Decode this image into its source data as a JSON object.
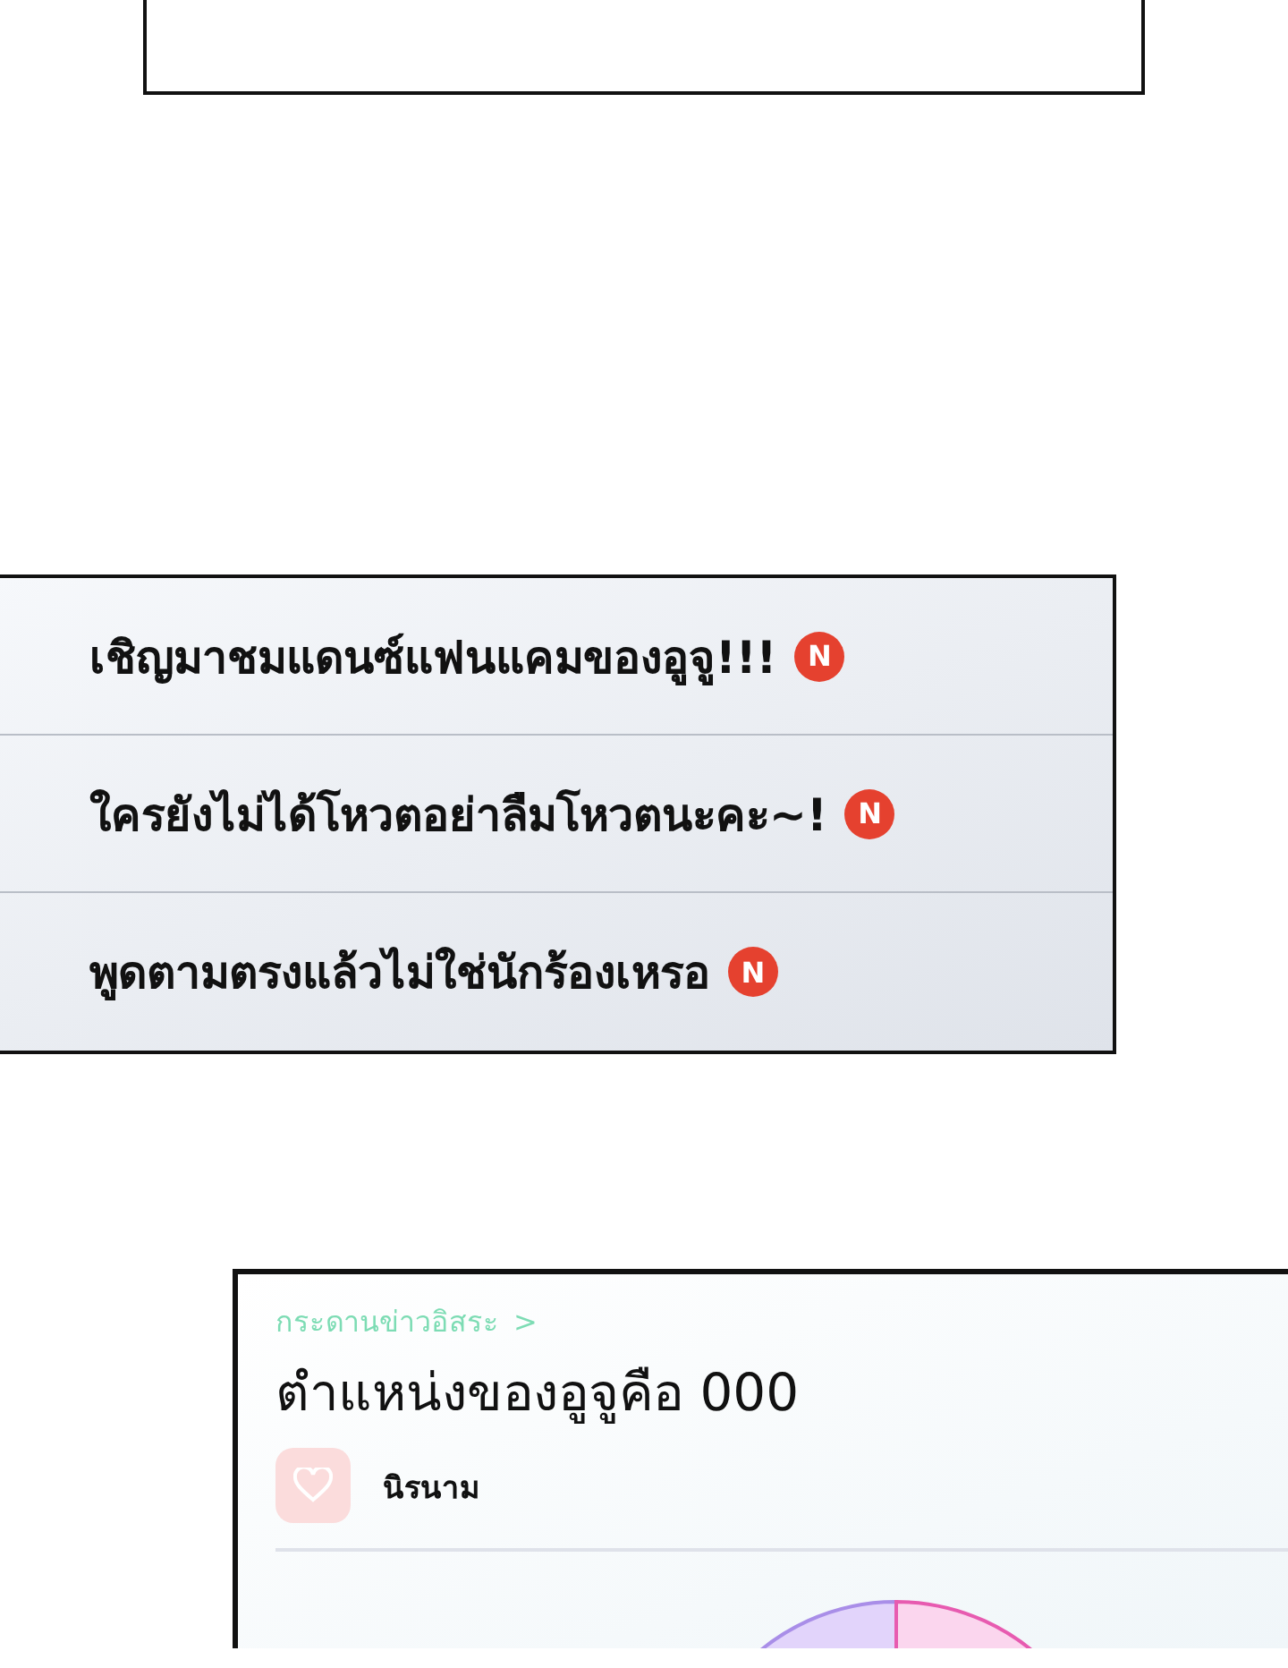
{
  "notices": [
    {
      "text": "เชิญมาชมแดนซ์แฟนแคมของอูจู!!!",
      "badge": "N"
    },
    {
      "text": "ใครยังไม่ได้โหวตอย่าลืมโหวตนะคะ~!",
      "badge": "N"
    },
    {
      "text": "พูดตามตรงแล้วไม่ใช่นักร้องเหรอ",
      "badge": "N"
    }
  ],
  "post": {
    "board": "กระดานข่าวอิสระ",
    "chevron": ">",
    "title": "ตำแหน่งของอูจูคือ 000",
    "author": "นิรนาม"
  }
}
